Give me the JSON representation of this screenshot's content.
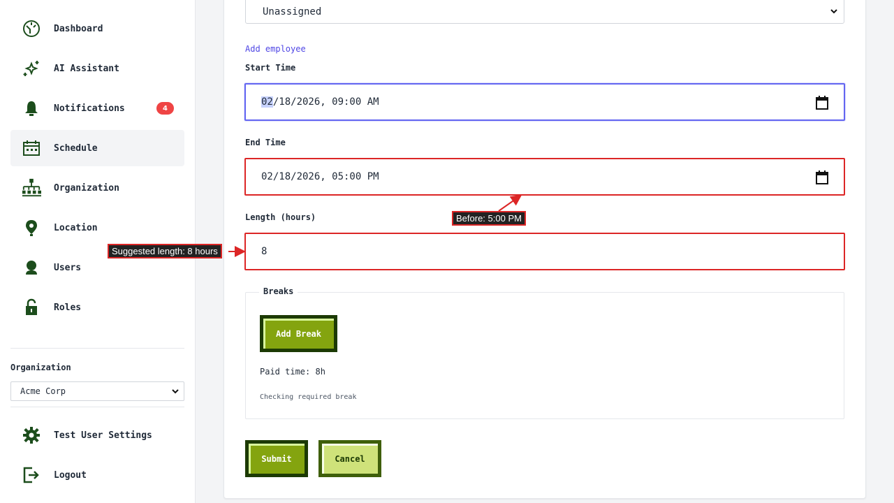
{
  "sidebar": {
    "nav_items": [
      {
        "label": "Dashboard",
        "icon": "dashboard-icon"
      },
      {
        "label": "AI Assistant",
        "icon": "sparkle-icon"
      },
      {
        "label": "Notifications",
        "icon": "bell-icon",
        "badge": "4"
      },
      {
        "label": "Schedule",
        "icon": "calendar-icon",
        "active": true
      },
      {
        "label": "Organization",
        "icon": "org-chart-icon"
      },
      {
        "label": "Location",
        "icon": "location-pin-icon"
      },
      {
        "label": "Users",
        "icon": "user-icon"
      },
      {
        "label": "Roles",
        "icon": "lock-icon"
      }
    ],
    "organization_label": "Organization",
    "organization_selected": "Acme Corp",
    "bottom_items": [
      {
        "label": "Test User Settings",
        "icon": "gear-icon"
      },
      {
        "label": "Logout",
        "icon": "logout-icon"
      }
    ]
  },
  "form": {
    "assigned_select_value": "Unassigned",
    "add_employee_link": "Add employee",
    "start_time_label": "Start Time",
    "start_time_month": "02",
    "start_time_rest": "/18/2026, 09:00 AM",
    "end_time_label": "End Time",
    "end_time_value": "02/18/2026, 05:00 PM",
    "length_label": "Length (hours)",
    "length_value": "8",
    "breaks_legend": "Breaks",
    "add_break_button": "Add Break",
    "paid_time": "Paid time: 8h",
    "checking_text": "Checking required break",
    "submit_button": "Submit",
    "cancel_button": "Cancel"
  },
  "annotations": {
    "before_end": "Before: 5:00 PM",
    "suggested_length": "Suggested length: 8 hours"
  },
  "colors": {
    "accent": "#6366f1",
    "error": "#dc2626",
    "badge": "#ef4444",
    "button_green": "#84a40f",
    "sidebar_icon": "#1c4d1c"
  }
}
